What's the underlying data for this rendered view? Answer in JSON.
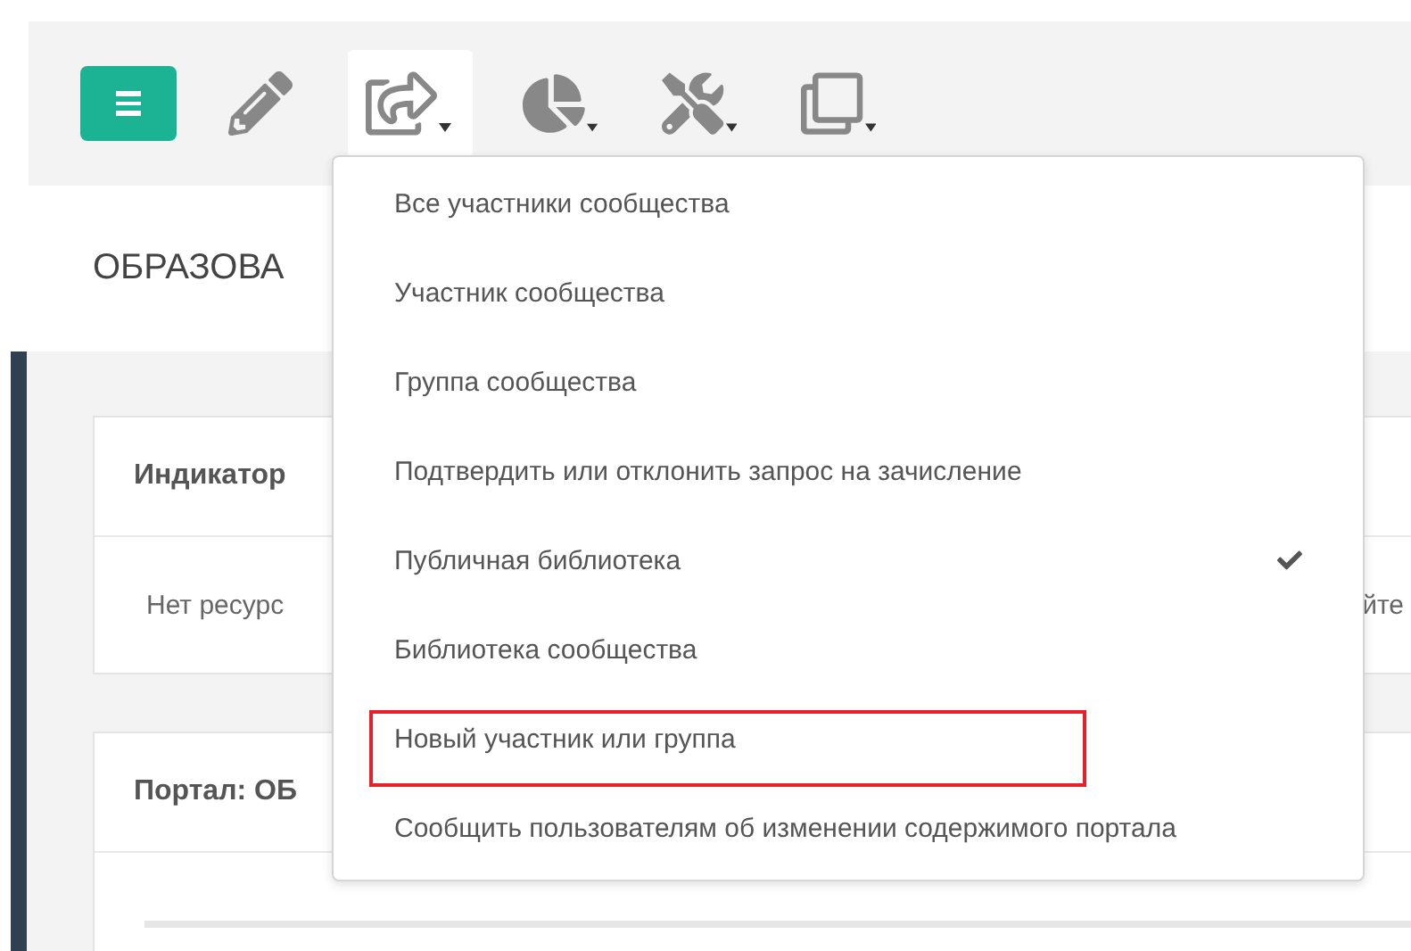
{
  "toolbar": {
    "buttons": [
      {
        "kind": "menu",
        "selected": false,
        "has_caret": false
      },
      {
        "kind": "edit",
        "selected": false,
        "has_caret": false
      },
      {
        "kind": "share",
        "selected": true,
        "has_caret": true
      },
      {
        "kind": "chart",
        "selected": false,
        "has_caret": true
      },
      {
        "kind": "tools",
        "selected": false,
        "has_caret": true
      },
      {
        "kind": "copy",
        "selected": false,
        "has_caret": true
      }
    ]
  },
  "page_title": "ОБРАЗОВА",
  "cards": [
    {
      "title": "Индикатор",
      "body": "Нет ресурс",
      "body_end": "йте"
    },
    {
      "title": "Портал: ОБ"
    }
  ],
  "menu": {
    "items": [
      {
        "label": "Все участники сообщества",
        "checked": false,
        "annotated": false
      },
      {
        "label": "Участник сообщества",
        "checked": false,
        "annotated": false
      },
      {
        "label": "Группа сообщества",
        "checked": false,
        "annotated": false
      },
      {
        "label": "Подтвердить или отклонить запрос на зачисление",
        "checked": false,
        "annotated": false
      },
      {
        "label": "Публичная библиотека",
        "checked": true,
        "annotated": false
      },
      {
        "label": "Библиотека сообщества",
        "checked": false,
        "annotated": false
      },
      {
        "label": "Новый участник или группа",
        "checked": false,
        "annotated": true
      },
      {
        "label": "Сообщить пользователям об изменении содержимого портала",
        "checked": false,
        "annotated": false
      }
    ]
  }
}
